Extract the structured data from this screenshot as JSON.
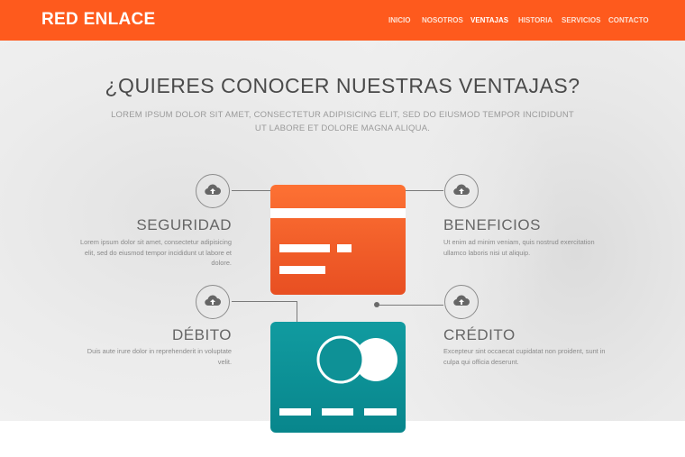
{
  "header": {
    "brand": "RED ENLACE",
    "nav": [
      {
        "label": "INICIO",
        "active": false
      },
      {
        "label": "NOSOTROS",
        "active": false
      },
      {
        "label": "VENTAJAS",
        "active": true
      },
      {
        "label": "HISTORIA",
        "active": false
      },
      {
        "label": "SERVICIOS",
        "active": false
      },
      {
        "label": "CONTACTO",
        "active": false
      }
    ]
  },
  "section": {
    "title": "¿QUIERES CONOCER NUESTRAS VENTAJAS?",
    "subtitle": "LOREM IPSUM DOLOR SIT AMET, CONSECTETUR ADIPISICING ELIT, SED DO EIUSMOD TEMPOR INCIDIDUNT UT LABORE ET DOLORE MAGNA ALIQUA."
  },
  "features": [
    {
      "title": "SEGURIDAD",
      "text": "Lorem ipsum dolor sit amet, consectetur adipisicing elit, sed do eiusmod tempor incididunt ut labore et dolore.",
      "icon": "cloud-upload-icon"
    },
    {
      "title": "BENEFICIOS",
      "text": "Ut enim ad minim veniam, quis nostrud exercitation ullamco laboris nisi ut aliquip.",
      "icon": "cloud-upload-icon"
    },
    {
      "title": "DÉBITO",
      "text": "Duis aute irure dolor in reprehenderit in voluptate velit.",
      "icon": "cloud-upload-icon"
    },
    {
      "title": "CRÉDITO",
      "text": "Excepteur sint occaecat cupidatat non proident, sunt in culpa qui officia deserunt.",
      "icon": "cloud-upload-icon"
    }
  ],
  "colors": {
    "brand": "#fe5a1d",
    "card_orange": "#f2602a",
    "card_teal": "#0e9196"
  }
}
